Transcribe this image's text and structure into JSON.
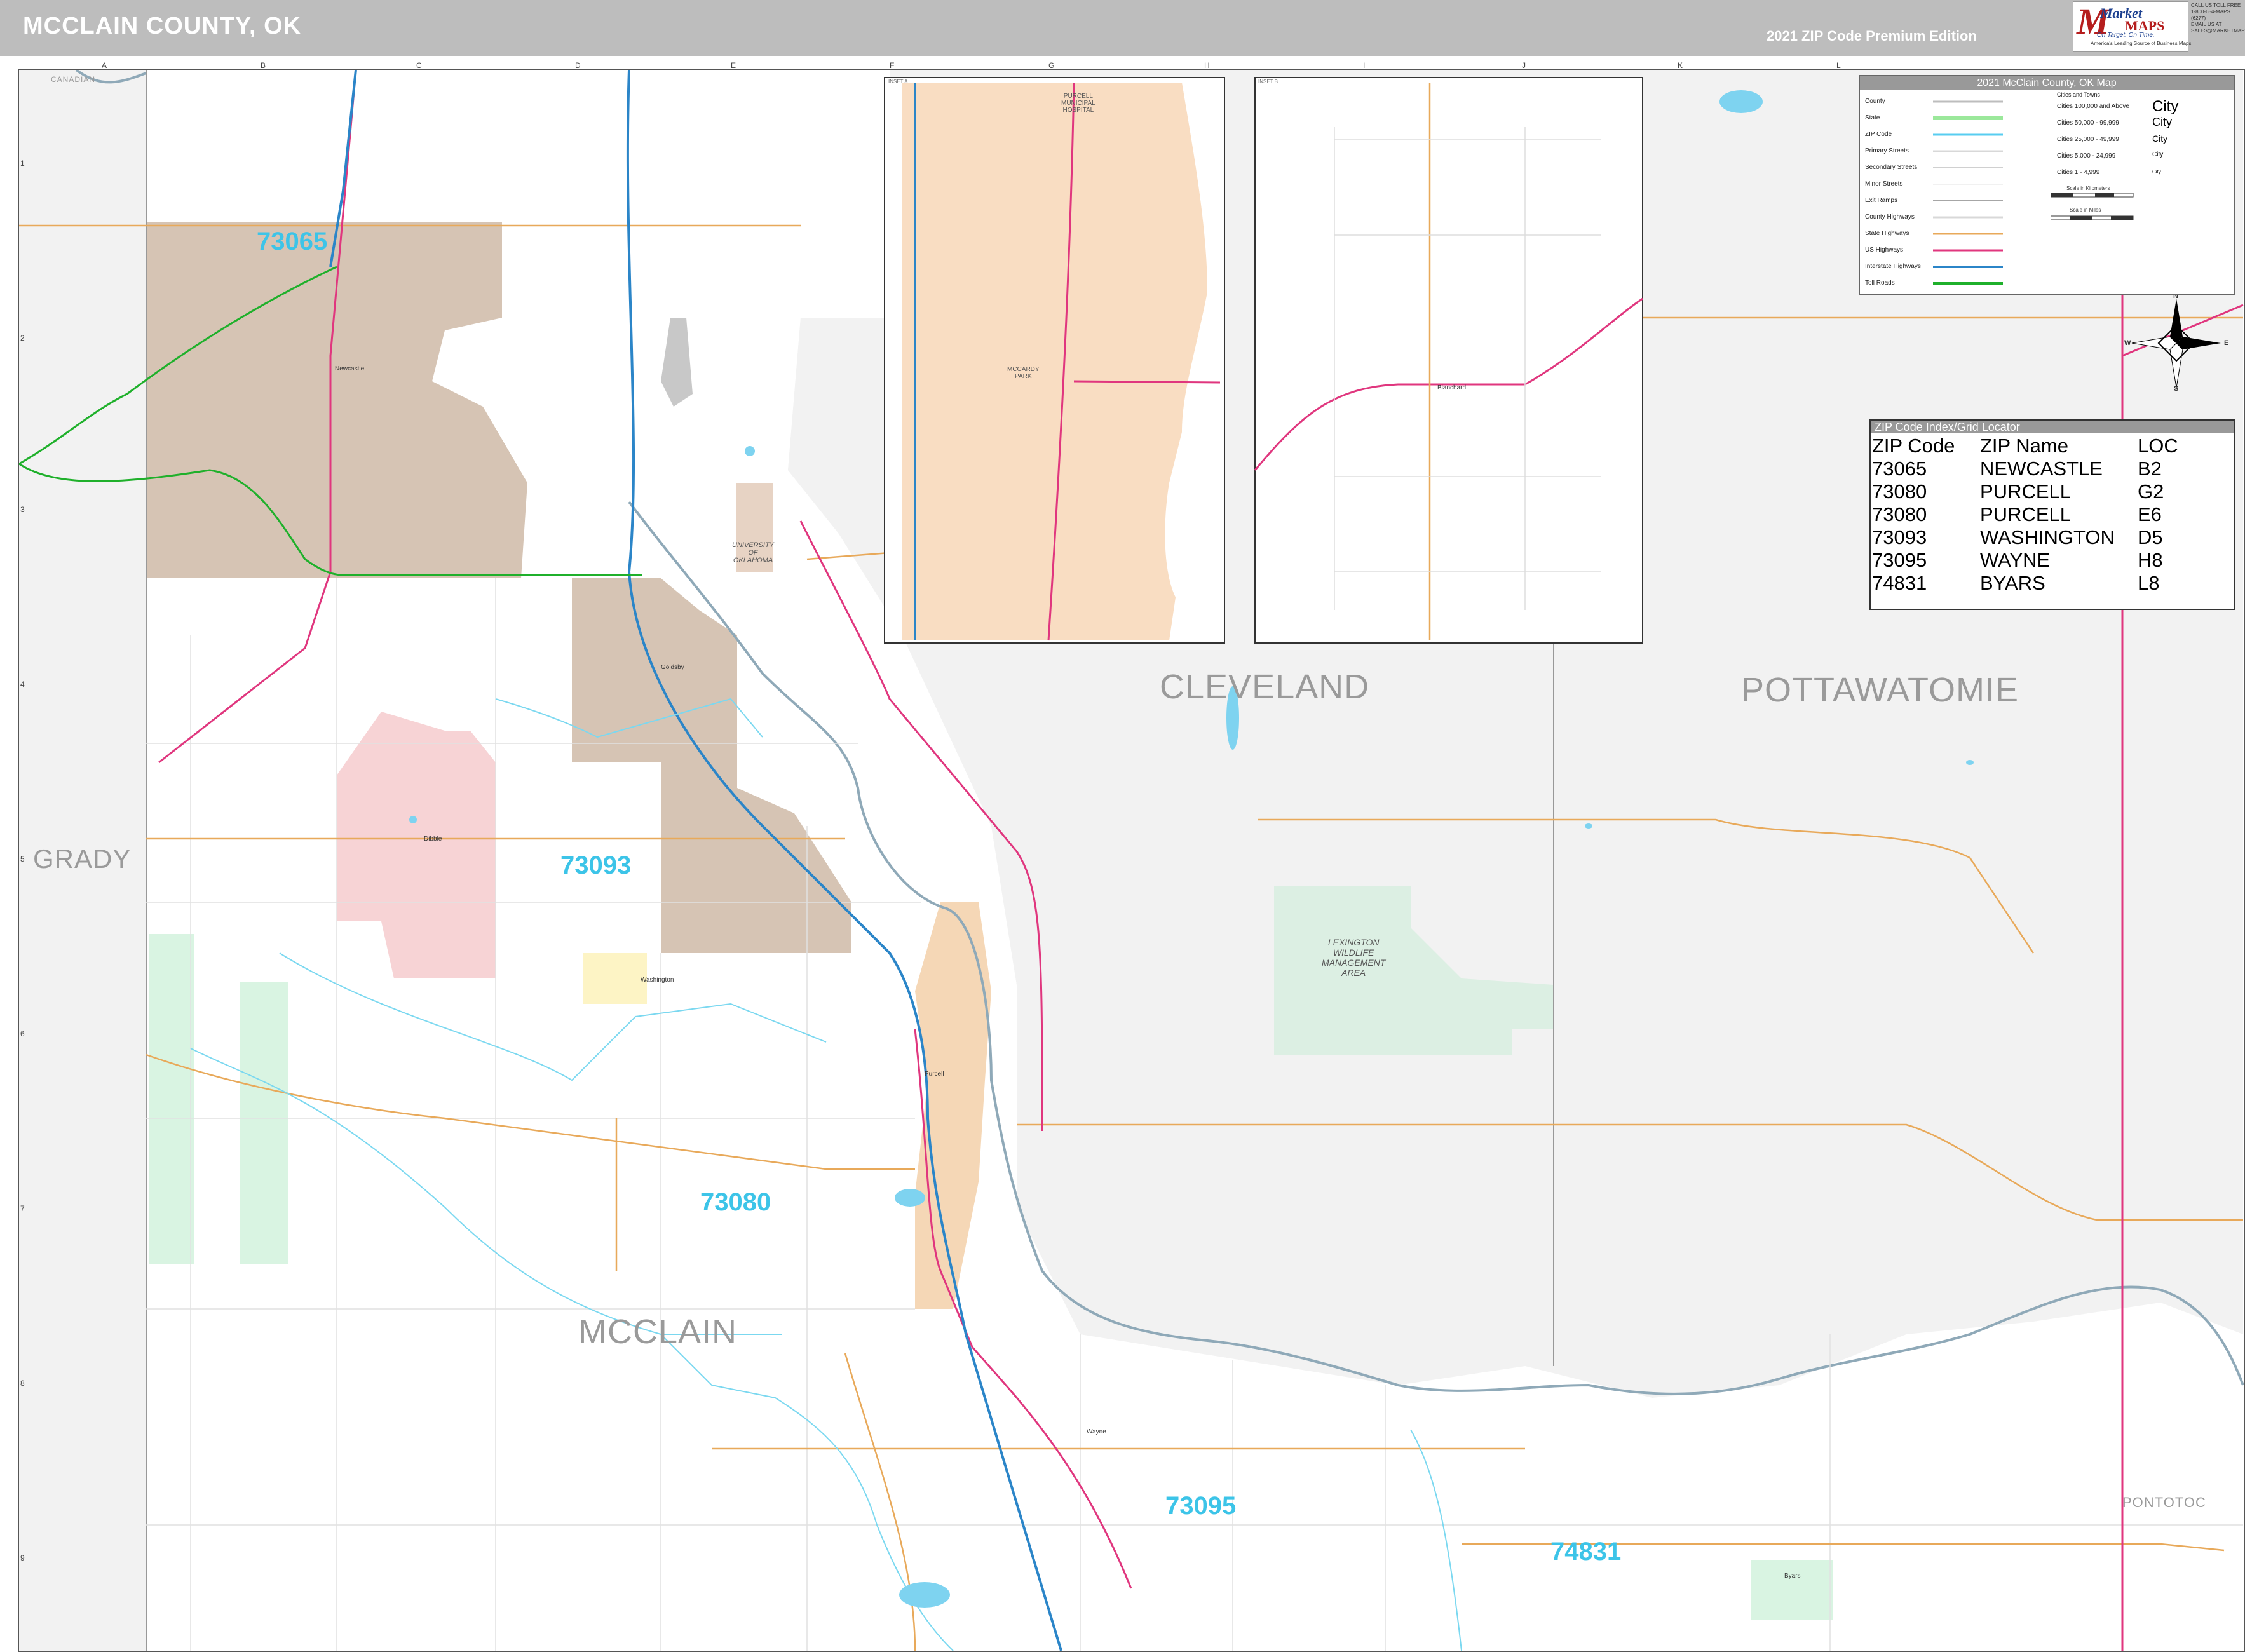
{
  "header": {
    "title": "MCCLAIN COUNTY, OK",
    "edition": "2021 ZIP Code Premium Edition",
    "logo_market": "Market",
    "logo_maps": "MAPS",
    "logo_tagline": "On Target. On Time.",
    "logo_subtag": "America's Leading Source of Business Maps",
    "contact_lines": [
      "CALL US TOLL FREE",
      "1-800-654-MAPS (6277)",
      "EMAIL US AT",
      "SALES@MARKETMAPS.COM"
    ]
  },
  "grid": {
    "columns": [
      "A",
      "B",
      "C",
      "D",
      "E",
      "F",
      "G",
      "H",
      "I",
      "J",
      "K",
      "L"
    ],
    "rows": [
      "1",
      "2",
      "3",
      "4",
      "5",
      "6",
      "7",
      "8",
      "9"
    ]
  },
  "legend": {
    "title": "2021 McClain County, OK Map",
    "rows": [
      "County",
      "State",
      "ZIP Code",
      "Primary Streets",
      "Secondary Streets",
      "Minor Streets",
      "Exit Ramps",
      "County Highways",
      "State Highways",
      "US Highways",
      "Interstate Highways",
      "Toll Roads"
    ],
    "cities_header": "Cities and Towns",
    "city_sizes": [
      {
        "label": "Cities 100,000 and Above",
        "sample": "City"
      },
      {
        "label": "Cities 50,000 - 99,999",
        "sample": "City"
      },
      {
        "label": "Cities 25,000 - 49,999",
        "sample": "City"
      },
      {
        "label": "Cities 5,000 - 24,999",
        "sample": "City"
      },
      {
        "label": "Cities 1 - 4,999",
        "sample": "City"
      }
    ],
    "scale_km": "Scale in Kilometers",
    "scale_mi": "Scale in Miles",
    "line_colors": {
      "county": "#bdbdbd",
      "state": "#9be89b",
      "zip": "#58cdf0",
      "primary": "#d8d8d8",
      "secondary": "#d0d0d0",
      "minor": "#e3e3e3",
      "exit": "#a6a6a6",
      "county_hwy": "#d8d8d8",
      "state_hwy": "#e8a95a",
      "us_hwy": "#e0367e",
      "interstate": "#2b85c8",
      "toll": "#1fb02b"
    }
  },
  "compass": {
    "n": "N",
    "e": "E",
    "s": "S",
    "w": "W"
  },
  "zip_index": {
    "title": "ZIP Code Index/Grid Locator",
    "headers": [
      "ZIP Code",
      "ZIP Name",
      "LOC"
    ],
    "rows": [
      [
        "73065",
        "NEWCASTLE",
        "B2"
      ],
      [
        "73080",
        "PURCELL",
        "G2"
      ],
      [
        "73080",
        "PURCELL",
        "E6"
      ],
      [
        "73093",
        "WASHINGTON",
        "D5"
      ],
      [
        "73095",
        "WAYNE",
        "H8"
      ],
      [
        "74831",
        "BYARS",
        "L8"
      ]
    ]
  },
  "counties": {
    "cleveland": "CLEVELAND",
    "pottawatomie": "POTTAWATOMIE",
    "grady": "GRADY",
    "mcclain": "MCCLAIN",
    "pontotoc": "PONTOTOC",
    "canadian": "CANADIAN"
  },
  "zips": {
    "z73065": "73065",
    "z73093": "73093",
    "z73080": "73080",
    "z73095": "73095",
    "z74831": "74831"
  },
  "places": {
    "lexington": [
      "LEXINGTON",
      "WILDLIFE",
      "MANAGEMENT",
      "AREA"
    ],
    "ou": [
      "UNIVERSITY",
      "OF",
      "OKLAHOMA"
    ],
    "purcell_hospital": [
      "PURCELL",
      "MUNICIPAL",
      "HOSPITAL"
    ],
    "mccardy_park": [
      "MCCARDY",
      "PARK"
    ],
    "newcastle": "Newcastle",
    "blanchard": "Blanchard",
    "purcell": "Purcell",
    "wayne": "Wayne",
    "byars": "Byars",
    "washington": "Washington",
    "dibble": "Dibble",
    "goldsby": "Goldsby"
  },
  "insets": {
    "inset_a": "INSET A",
    "inset_b": "INSET B"
  }
}
